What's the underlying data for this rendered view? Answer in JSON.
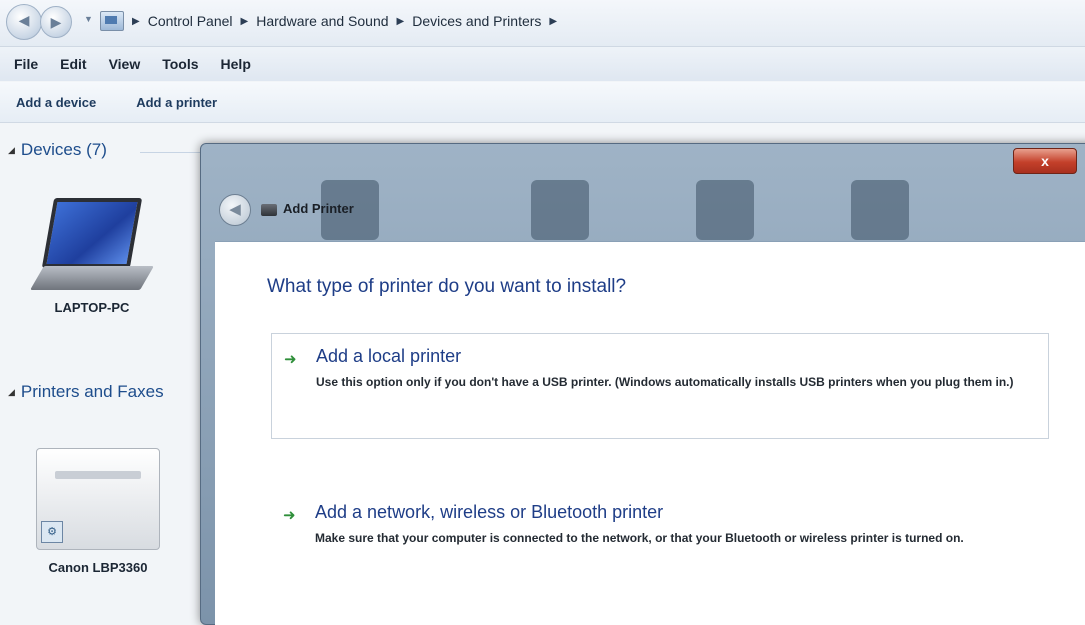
{
  "breadcrumb": {
    "items": [
      "Control Panel",
      "Hardware and Sound",
      "Devices and Printers"
    ]
  },
  "menu": {
    "items": [
      "File",
      "Edit",
      "View",
      "Tools",
      "Help"
    ]
  },
  "commands": {
    "add_device": "Add a device",
    "add_printer": "Add a printer"
  },
  "groups": {
    "devices": "Devices (7)",
    "printers": "Printers and Faxes"
  },
  "devices": {
    "laptop_label": "LAPTOP-PC",
    "printer_label": "Canon LBP3360"
  },
  "wizard": {
    "title": "Add Printer",
    "close_glyph": "x",
    "heading": "What type of printer do you want to install?",
    "options": [
      {
        "title": "Add a local printer",
        "description": "Use this option only if you don't have a USB printer. (Windows automatically installs USB printers when you plug them in.)"
      },
      {
        "title": "Add a network, wireless or Bluetooth printer",
        "description": "Make sure that your computer is connected to the network, or that your Bluetooth or wireless printer is turned on."
      }
    ]
  },
  "icons": {
    "back": "back-arrow-icon",
    "forward": "forward-arrow-icon",
    "control_panel": "control-panel-icon",
    "option_arrow": "green-arrow-icon",
    "printer_small": "printer-icon"
  },
  "colors": {
    "link_blue": "#1e3d87",
    "option_arrow_green": "#2f8f3a",
    "close_red": "#c4402a"
  }
}
